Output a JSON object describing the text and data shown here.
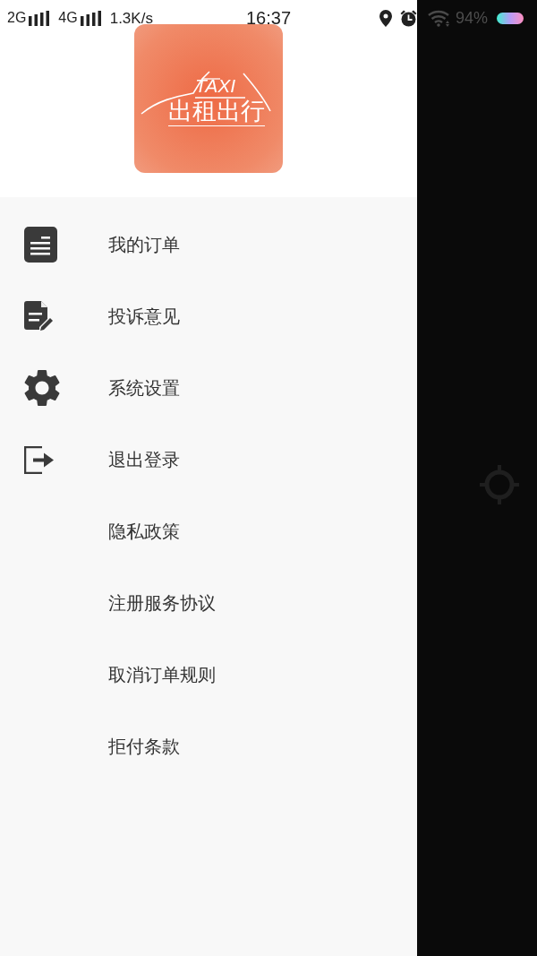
{
  "status_bar": {
    "networks": [
      {
        "label": "2G"
      },
      {
        "label": "4G"
      }
    ],
    "speed": "1.3K/s",
    "time": "16:37",
    "battery": "94%"
  },
  "drawer": {
    "logo": {
      "mark": "TAXI",
      "name": "出租出行"
    },
    "items": [
      {
        "label": "我的订单",
        "kind": "icon"
      },
      {
        "label": "投诉意见",
        "kind": "icon"
      },
      {
        "label": "系统设置",
        "kind": "icon"
      },
      {
        "label": "退出登录",
        "kind": "icon"
      },
      {
        "label": "隐私政策",
        "kind": "text"
      },
      {
        "label": "注册服务协议",
        "kind": "text"
      },
      {
        "label": "取消订单规则",
        "kind": "text"
      },
      {
        "label": "拒付条款",
        "kind": "text"
      }
    ]
  }
}
